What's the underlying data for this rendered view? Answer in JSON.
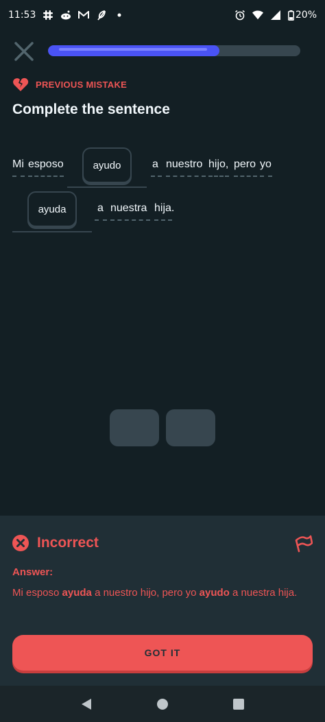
{
  "status_bar": {
    "time": "11:53",
    "battery": "20%",
    "left_icons": [
      "slack-icon",
      "reddit-icon",
      "gmail-icon",
      "feather-icon",
      "dot-icon"
    ],
    "right_icons": [
      "alarm-icon",
      "wifi-icon",
      "signal-icon",
      "battery-icon"
    ]
  },
  "header": {
    "progress": 0.68
  },
  "prev_mistake": {
    "label": "PREVIOUS MISTAKE"
  },
  "title": "Complete the sentence",
  "sentence": {
    "w1": "Mi",
    "w2": "esposo",
    "chip1": "ayudo",
    "w3": "a",
    "w4": "nuestro",
    "w5": "hijo,",
    "w6": "pero",
    "w7": "yo",
    "chip2": "ayuda",
    "w8": "a",
    "w9": "nuestra",
    "w10": "hija."
  },
  "result": {
    "title": "Incorrect",
    "answer_label": "Answer:",
    "answer_parts": {
      "p1": "Mi esposo ",
      "b1": "ayuda",
      "p2": " a nuestro hijo, pero yo ",
      "b2": "ayudo",
      "p3": " a nuestra hija."
    },
    "button": "GOT IT"
  },
  "colors": {
    "background": "#131f24",
    "accent_red": "#ee5555",
    "progress_blue": "#4a53f5",
    "panel": "#202f36"
  }
}
